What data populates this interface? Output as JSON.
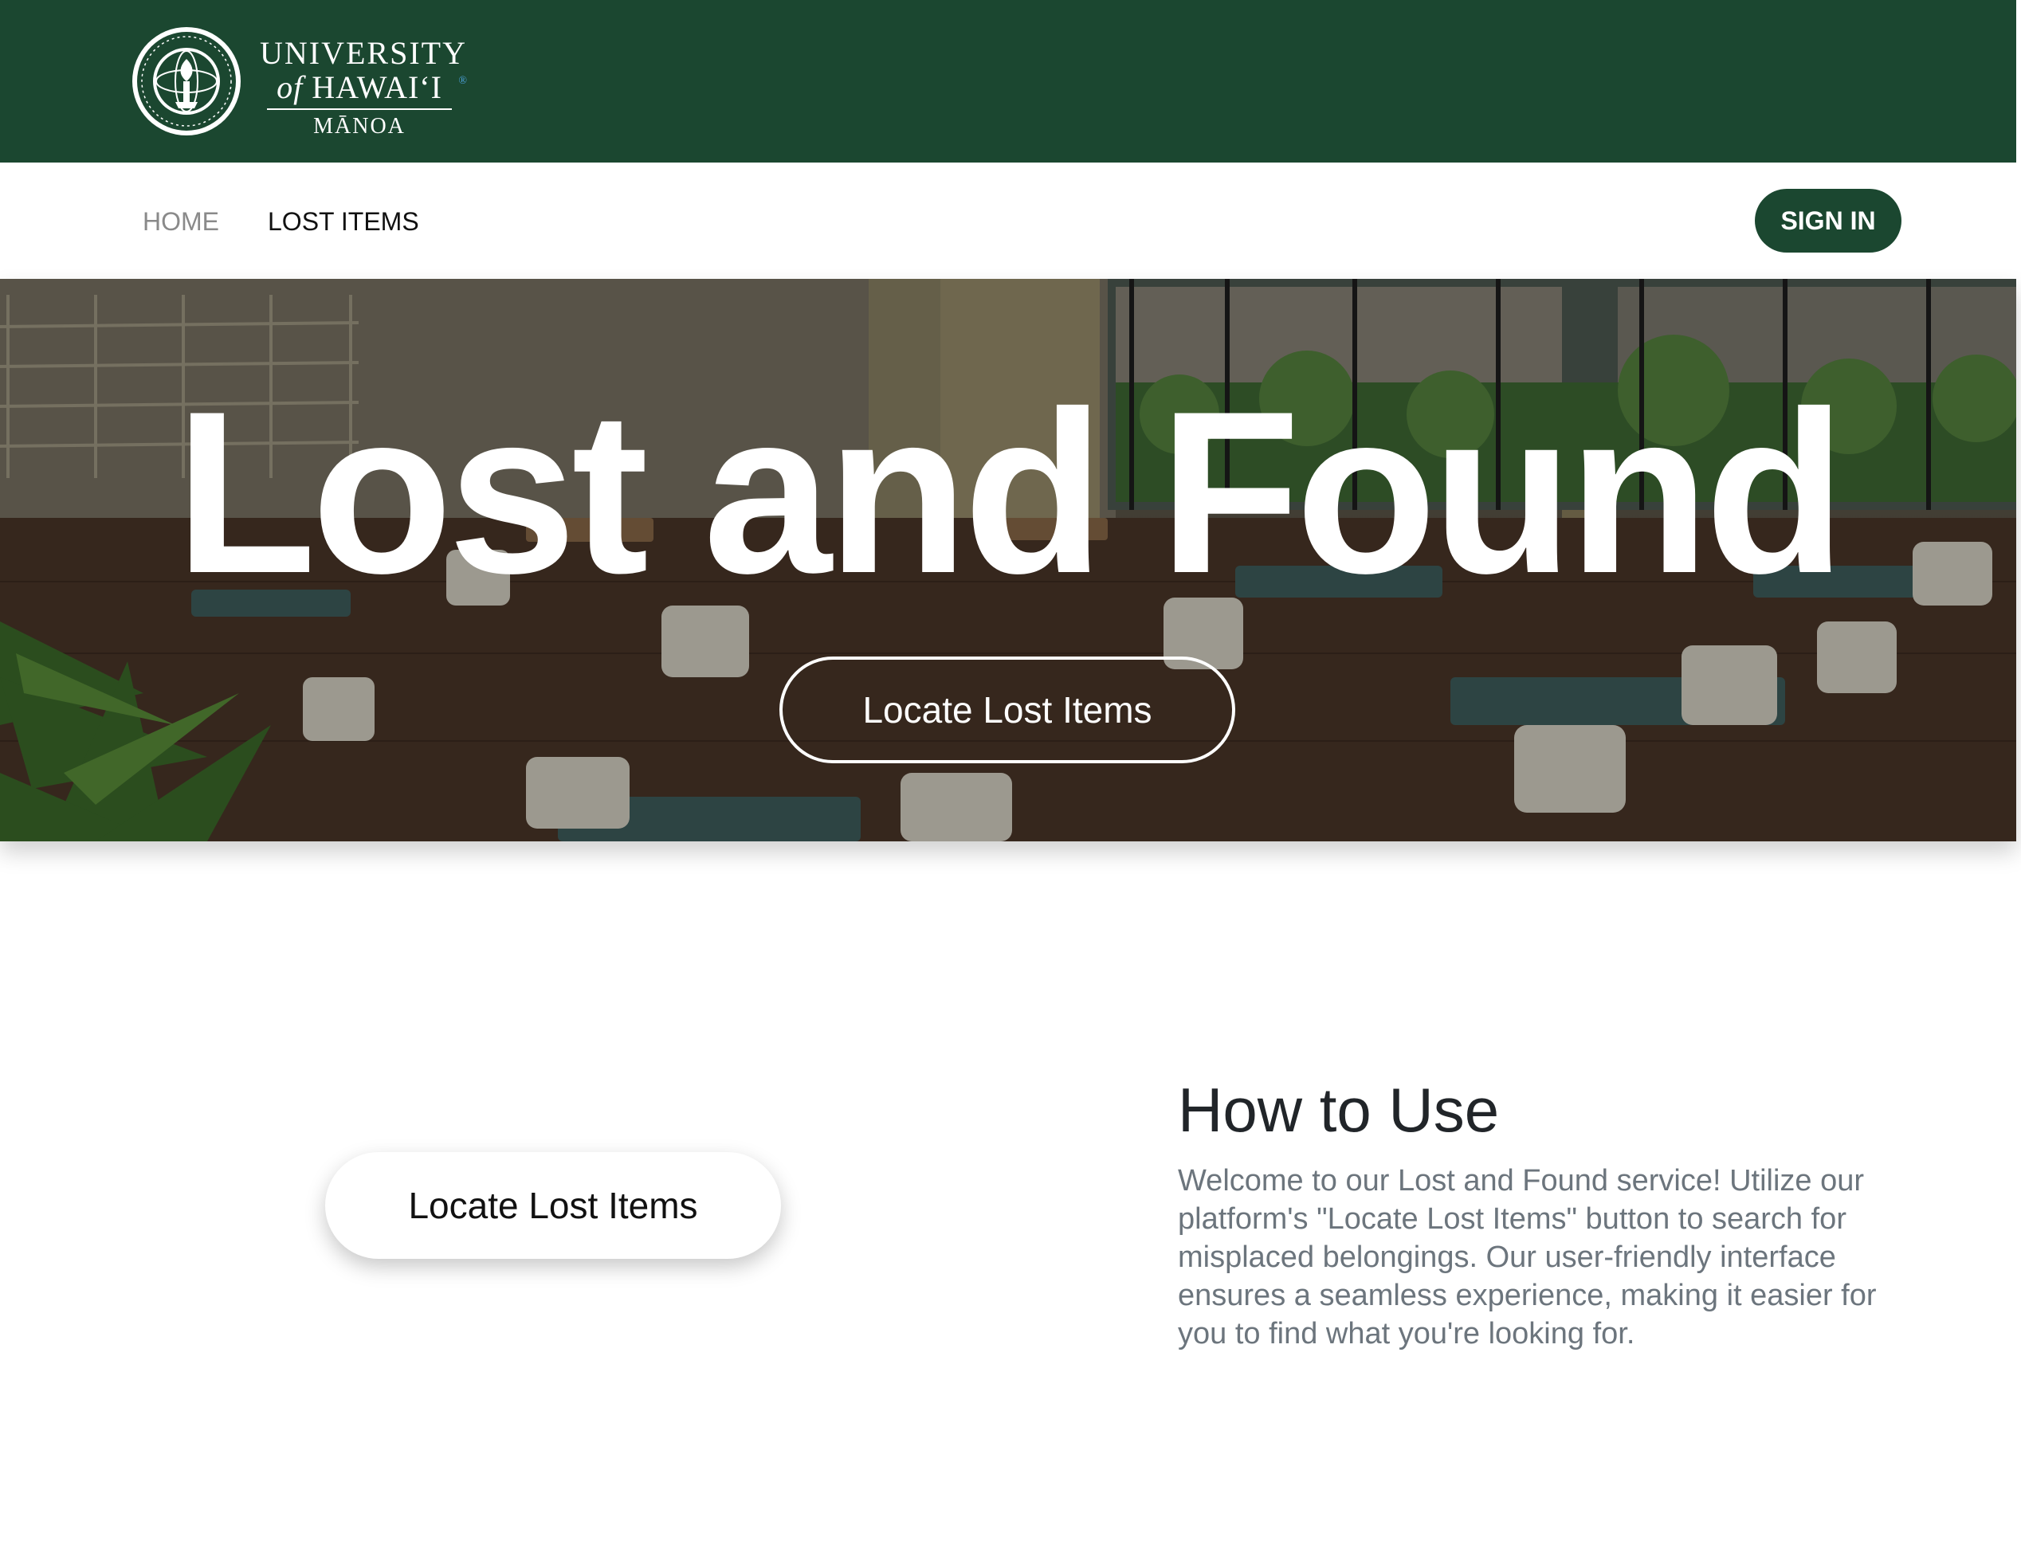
{
  "brand": {
    "line1": "UNIVERSITY",
    "line2_of": "of",
    "line2_name": "HAWAI‘I",
    "line3": "MĀNOA",
    "seal_icon": "university-seal-icon",
    "bar_color": "#1b4730"
  },
  "nav": {
    "home_label": "HOME",
    "lost_items_label": "LOST ITEMS",
    "sign_in_label": "SIGN IN"
  },
  "hero": {
    "title": "Lost and Found",
    "button_label": "Locate Lost Items"
  },
  "how_to_use": {
    "button_label": "Locate Lost Items",
    "title": "How to Use",
    "body": "Welcome to our Lost and Found service! Utilize our platform's \"Locate Lost Items\" button to search for misplaced belongings. Our user-friendly interface ensures a seamless experience, making it easier for you to find what you're looking for."
  },
  "colors": {
    "accent": "#1b4730",
    "muted_text": "#6c757d"
  }
}
